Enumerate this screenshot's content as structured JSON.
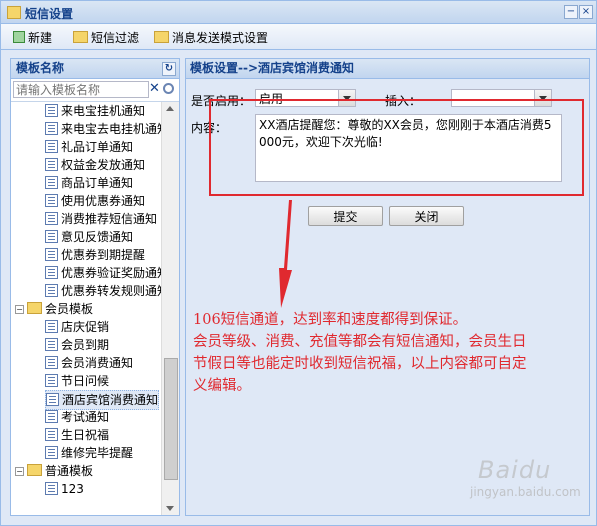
{
  "window": {
    "title": "短信设置"
  },
  "toolbar": {
    "new_label": "新建",
    "filter_label": "短信过滤",
    "mode_label": "消息发送模式设置"
  },
  "left_panel": {
    "title": "模板名称",
    "search_placeholder": "请输入模板名称",
    "tree": [
      {
        "type": "leaf",
        "label": "来电宝挂机通知"
      },
      {
        "type": "leaf",
        "label": "来电宝去电挂机通知"
      },
      {
        "type": "leaf",
        "label": "礼品订单通知"
      },
      {
        "type": "leaf",
        "label": "权益金发放通知"
      },
      {
        "type": "leaf",
        "label": "商品订单通知"
      },
      {
        "type": "leaf",
        "label": "使用优惠券通知"
      },
      {
        "type": "leaf",
        "label": "消费推荐短信通知"
      },
      {
        "type": "leaf",
        "label": "意见反馈通知"
      },
      {
        "type": "leaf",
        "label": "优惠券到期提醒"
      },
      {
        "type": "leaf",
        "label": "优惠券验证奖励通知"
      },
      {
        "type": "leaf",
        "label": "优惠券转发规则通知"
      },
      {
        "type": "folder",
        "label": "会员模板"
      },
      {
        "type": "leaf",
        "label": "店庆促销"
      },
      {
        "type": "leaf",
        "label": "会员到期"
      },
      {
        "type": "leaf",
        "label": "会员消费通知"
      },
      {
        "type": "leaf",
        "label": "节日问候"
      },
      {
        "type": "leaf",
        "label": "酒店宾馆消费通知",
        "selected": true
      },
      {
        "type": "leaf",
        "label": "考试通知"
      },
      {
        "type": "leaf",
        "label": "生日祝福"
      },
      {
        "type": "leaf",
        "label": "维修完毕提醒"
      },
      {
        "type": "folder",
        "label": "普通模板"
      },
      {
        "type": "leaf",
        "label": "123"
      }
    ]
  },
  "right_panel": {
    "title": "模板设置-->酒店宾馆消费通知",
    "enable_label": "是否启用：",
    "enable_value": "启用",
    "insert_label": "插入：",
    "insert_value": "",
    "content_label": "内容：",
    "content_value": "XX酒店提醒您：尊敬的XX会员，您刚刚于本酒店消费5000元，欢迎下次光临!",
    "submit_label": "提交",
    "close_label": "关闭"
  },
  "annotation": {
    "line1": "106短信通道，达到率和速度都得到保证。",
    "line2": "会员等级、消费、充值等都会有短信通知，会员生日",
    "line3": "节假日等也能定时收到短信祝福，以上内容都可自定",
    "line4": "义编辑。",
    "color": "#e0292f"
  },
  "watermark": {
    "text": "Baidu",
    "sub": "jingyan.baidu.com"
  }
}
